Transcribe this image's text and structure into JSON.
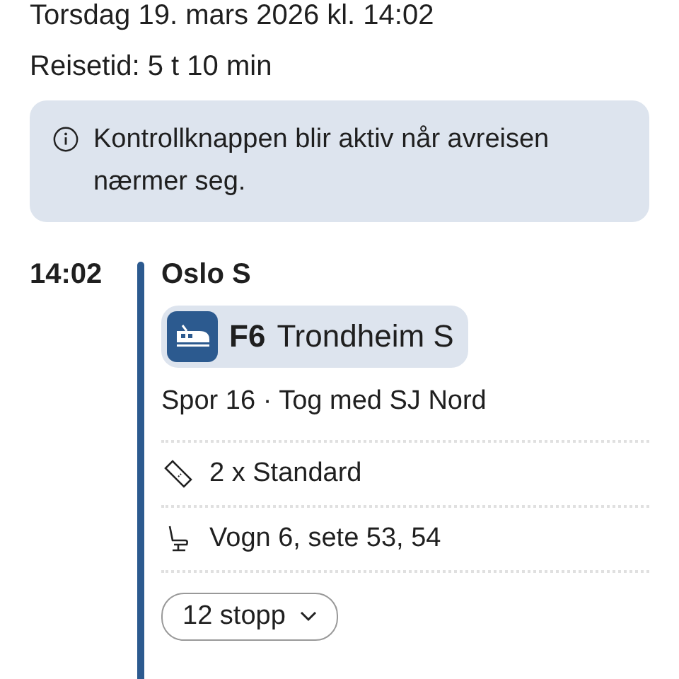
{
  "departure_date": "Torsdag 19. mars 2026 kl. 14:02",
  "travel_time": "Reisetid: 5 t 10 min",
  "info_notice": "Kontrollknappen blir aktiv når avreisen nærmer seg.",
  "leg": {
    "time": "14:02",
    "station": "Oslo S",
    "line": "F6",
    "destination": "Trondheim S",
    "details": "Spor 16 · Tog med SJ Nord",
    "items": [
      {
        "kind": "ticket",
        "text": "2 x Standard"
      },
      {
        "kind": "seat",
        "text": "Vogn 6, sete 53, 54"
      }
    ],
    "stops_button": "12 stopp"
  }
}
